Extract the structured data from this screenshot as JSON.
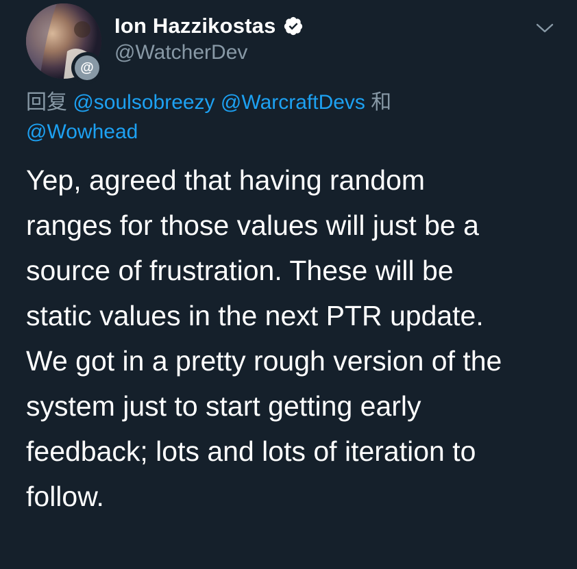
{
  "author": {
    "display_name": "Ion Hazzikostas",
    "handle": "@WatcherDev",
    "verified": true,
    "avatar_badge": "@"
  },
  "reply": {
    "prefix": "回复",
    "mentions": [
      "@soulsobreezy",
      "@WarcraftDevs",
      "@Wowhead"
    ],
    "conjunction": "和"
  },
  "tweet": {
    "text": "Yep, agreed that having random\nranges for those values will just be a\nsource of frustration. These will be\nstatic values in the next PTR update.\nWe got in a pretty rough version of the\nsystem just to start getting early\nfeedback; lots and lots of iteration to\nfollow."
  },
  "icons": {
    "verified": "verified-badge-icon",
    "menu": "chevron-down-icon",
    "avatar_badge": "at-sign-icon"
  },
  "colors": {
    "background": "#15202b",
    "text": "#ffffff",
    "secondary_text": "#8899a6",
    "link": "#1da1f2"
  }
}
